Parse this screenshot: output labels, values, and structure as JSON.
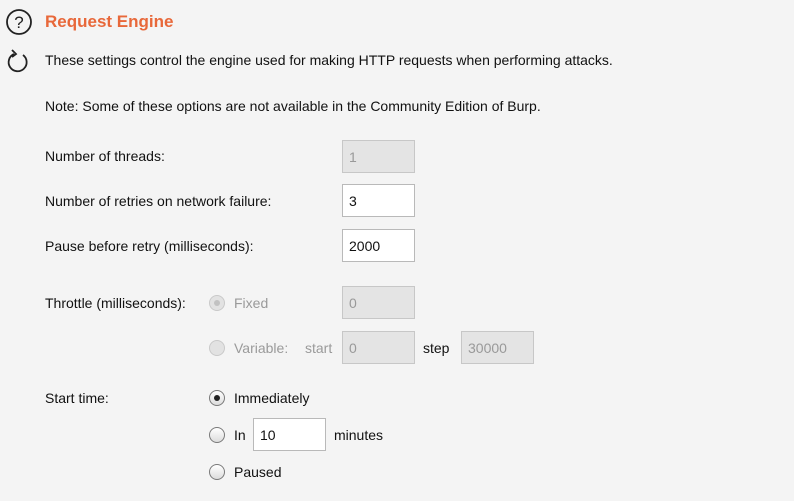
{
  "section": {
    "title": "Request Engine",
    "description": "These settings control the engine used for making HTTP requests when performing attacks.",
    "note": "Note: Some of these options are not available in the Community Edition of Burp."
  },
  "icons": {
    "help": "help-icon",
    "refresh": "refresh-icon",
    "accent_color": "#e8683a"
  },
  "threads": {
    "label": "Number of threads:",
    "value": "1",
    "enabled": false
  },
  "retries": {
    "label": "Number of retries on network failure:",
    "value": "3"
  },
  "pause": {
    "label": "Pause before retry (milliseconds):",
    "value": "2000"
  },
  "throttle": {
    "label": "Throttle (milliseconds):",
    "fixed_label": "Fixed",
    "fixed_value": "0",
    "variable_label": "Variable:",
    "start_label": "start",
    "start_value": "0",
    "step_label": "step",
    "step_value": "30000",
    "enabled": false
  },
  "start_time": {
    "label": "Start time:",
    "immediately_label": "Immediately",
    "in_label": "In",
    "in_value": "10",
    "minutes_label": "minutes",
    "paused_label": "Paused",
    "selected": "Immediately"
  }
}
